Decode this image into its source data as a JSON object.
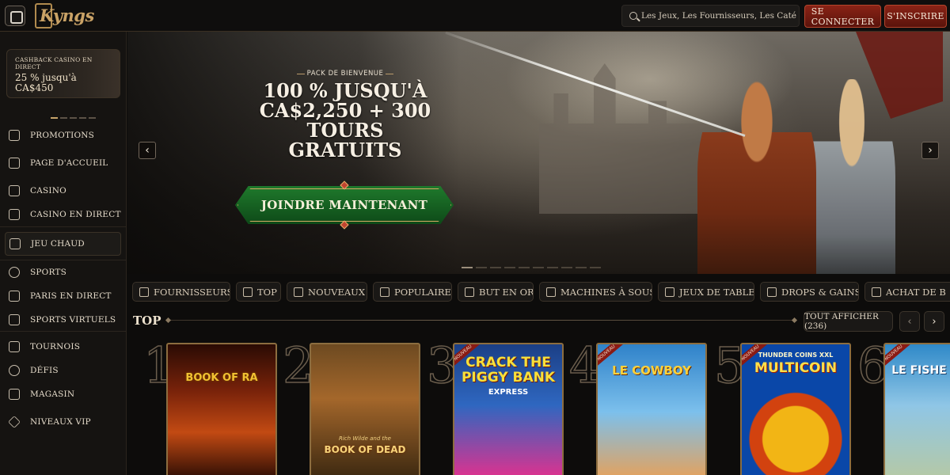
{
  "header": {
    "logo_text": "Kyngs",
    "search_placeholder": "Les Jeux, Les Fournisseurs, Les Catégories",
    "login_label": "SE CONNECTER",
    "register_label": "S'INSCRIRE"
  },
  "sidebar": {
    "cashback": {
      "title": "CASHBACK CASINO EN DIRECT",
      "value": "25 % jusqu'à CA$450"
    },
    "items": [
      {
        "label": "PROMOTIONS",
        "icon": "gift-icon"
      },
      {
        "label": "PAGE D'ACCUEIL",
        "icon": "castle-icon"
      },
      {
        "label": "CASINO",
        "icon": "casino-building-icon"
      },
      {
        "label": "CASINO EN DIRECT",
        "icon": "cards-icon"
      },
      {
        "label": "JEU CHAUD",
        "icon": "flame-icon"
      },
      {
        "label": "SPORTS",
        "icon": "soccer-ball-icon"
      },
      {
        "label": "PARIS EN DIRECT",
        "icon": "live-icon"
      },
      {
        "label": "SPORTS VIRTUELS",
        "icon": "virtual-screen-icon"
      },
      {
        "label": "TOURNOIS",
        "icon": "trophy-icon"
      },
      {
        "label": "DÉFIS",
        "icon": "medal-icon"
      },
      {
        "label": "MAGASIN",
        "icon": "shop-icon"
      },
      {
        "label": "NIVEAUX VIP",
        "icon": "diamond-icon"
      }
    ]
  },
  "hero": {
    "subtitle": "PACK DE BIENVENUE",
    "title": "100 % JUSQU'À CA$2,250 + 300 TOURS GRATUITS",
    "cta": "JOINDRE MAINTENANT",
    "prev": "‹",
    "next": "›"
  },
  "tabs": [
    {
      "label": "FOURNISSEURS",
      "icon": "books-icon"
    },
    {
      "label": "TOP",
      "icon": "lightning-icon"
    },
    {
      "label": "NOUVEAUX",
      "icon": "new-icon"
    },
    {
      "label": "POPULAIRE",
      "icon": "flame-icon"
    },
    {
      "label": "BUT EN OR",
      "icon": "trophy-icon"
    },
    {
      "label": "MACHINES À SOUS",
      "icon": "slot-icon"
    },
    {
      "label": "JEUX DE TABLE",
      "icon": "table-icon"
    },
    {
      "label": "DROPS & GAINS",
      "icon": "drops-icon"
    },
    {
      "label": "ACHAT DE B",
      "icon": "gift-icon"
    }
  ],
  "top_section": {
    "title": "TOP",
    "show_all": "TOUT AFFICHER (236)",
    "prev": "‹",
    "next": "›"
  },
  "games": [
    {
      "rank": "1",
      "title": "BOOK OF RA",
      "new": false,
      "colors": [
        "#1f0a04",
        "#c24a13"
      ]
    },
    {
      "rank": "2",
      "title": "BOOK OF DEAD",
      "subtitle": "Rich Wilde and the",
      "new": false,
      "colors": [
        "#3a2710",
        "#a4672b"
      ]
    },
    {
      "rank": "3",
      "title": "CRACK THE PIGGY BANK",
      "subtitle": "EXPRESS",
      "new": true,
      "new_label": "NOUVEAU",
      "colors": [
        "#1b3f86",
        "#e3308d"
      ]
    },
    {
      "rank": "4",
      "title": "LE COWBOY",
      "new": true,
      "new_label": "NOUVEAU",
      "colors": [
        "#2f82c9",
        "#e6a15a"
      ]
    },
    {
      "rank": "5",
      "title": "MULTICOIN",
      "subtitle": "THUNDER COINS XXL",
      "new": true,
      "new_label": "NOUVEAU",
      "colors": [
        "#0a47a8",
        "#f2b515"
      ]
    },
    {
      "rank": "6",
      "title": "LE FISHE",
      "new": true,
      "new_label": "NOUVEAU",
      "colors": [
        "#2f89c8",
        "#b6c9a4"
      ]
    }
  ]
}
